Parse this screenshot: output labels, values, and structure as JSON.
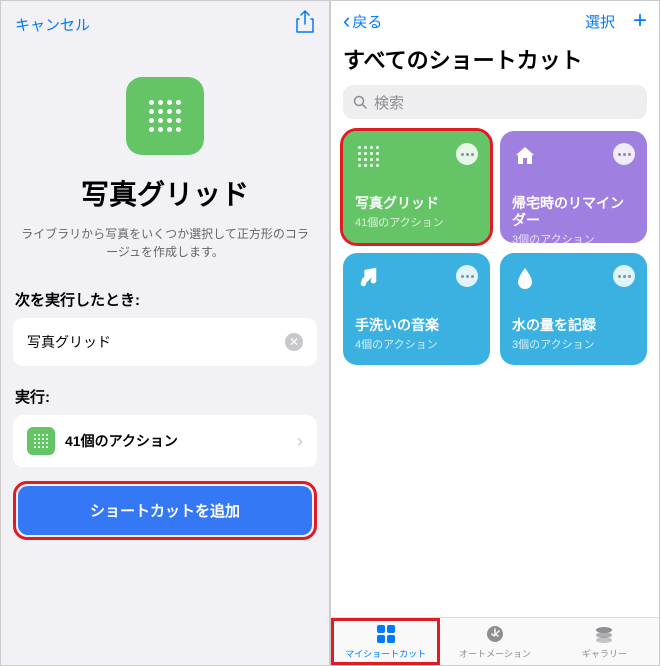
{
  "left": {
    "cancel": "キャンセル",
    "title": "写真グリッド",
    "desc": "ライブラリから写真をいくつか選択して正方形のコラージュを作成します。",
    "when_label": "次を実行したとき:",
    "when_value": "写真グリッド",
    "exec_label": "実行:",
    "exec_value": "41個のアクション",
    "add_button": "ショートカットを追加"
  },
  "right": {
    "back": "戻る",
    "select": "選択",
    "title": "すべてのショートカット",
    "search_placeholder": "検索",
    "cards": [
      {
        "title": "写真グリッド",
        "sub": "41個のアクション"
      },
      {
        "title": "帰宅時のリマインダー",
        "sub": "3個のアクション"
      },
      {
        "title": "手洗いの音楽",
        "sub": "4個のアクション"
      },
      {
        "title": "水の量を記録",
        "sub": "3個のアクション"
      }
    ],
    "tabs": [
      "マイショートカット",
      "オートメーション",
      "ギャラリー"
    ]
  }
}
